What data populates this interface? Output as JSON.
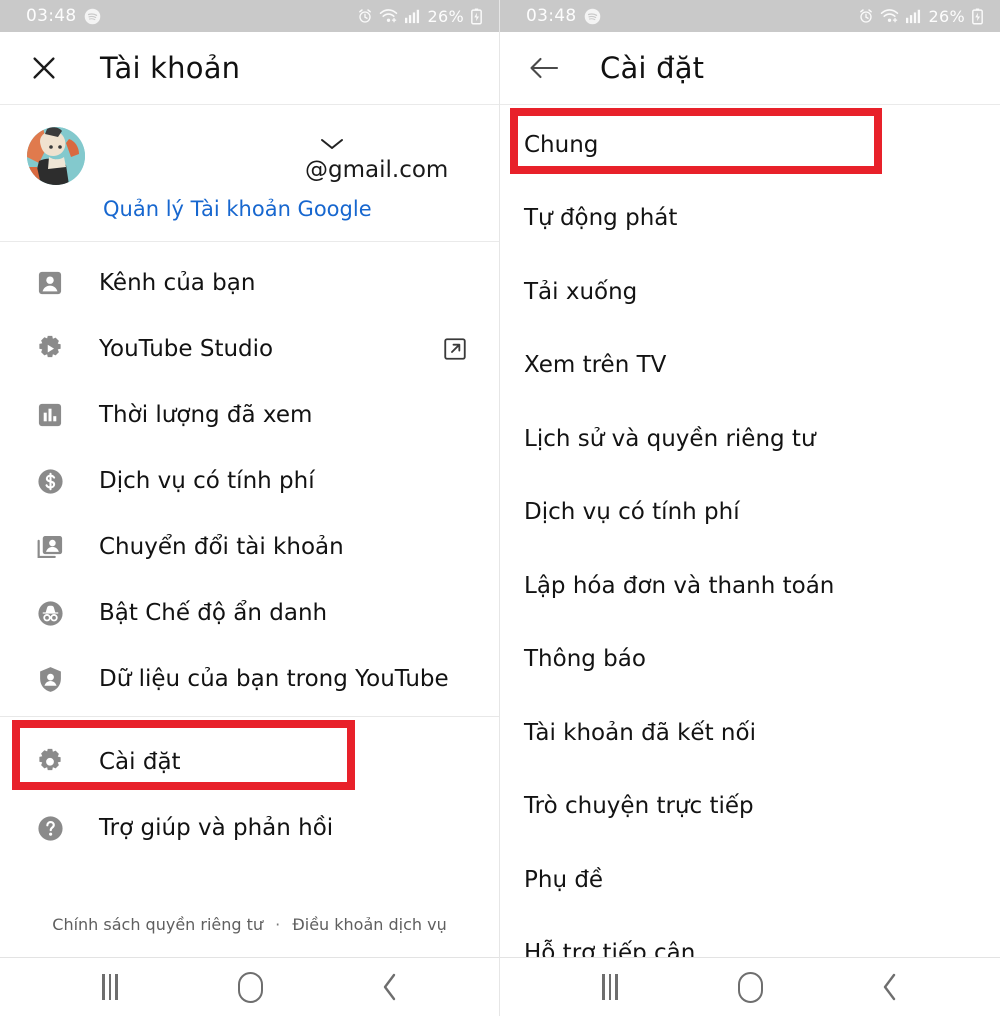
{
  "status_bar": {
    "time": "03:48",
    "spotify_icon": "spotify-icon",
    "alarm_icon": "alarm-clock-icon",
    "wifi_icon": "wifi-plus-icon",
    "signal_icon": "cellular-signal-icon",
    "battery_percent": "26%",
    "battery_icon": "battery-charging-icon"
  },
  "left_panel": {
    "appbar": {
      "close_icon": "close-x-icon",
      "title": "Tài khoản"
    },
    "account": {
      "avatar": "user-avatar",
      "expand_icon": "chevron-down-icon",
      "email": "@gmail.com",
      "manage_link": "Quản lý Tài khoản Google"
    },
    "menu": [
      {
        "icon": "account-box-icon",
        "label": "Kênh của bạn",
        "trailing": null
      },
      {
        "icon": "youtube-studio-icon",
        "label": "YouTube Studio",
        "trailing": "open-in-new-icon"
      },
      {
        "icon": "bar-chart-icon",
        "label": "Thời lượng đã xem",
        "trailing": null
      },
      {
        "icon": "dollar-circle-icon",
        "label": "Dịch vụ có tính phí",
        "trailing": null
      },
      {
        "icon": "switch-account-icon",
        "label": "Chuyển đổi tài khoản",
        "trailing": null
      },
      {
        "icon": "incognito-icon",
        "label": "Bật Chế độ ẩn danh",
        "trailing": null
      },
      {
        "icon": "shield-person-icon",
        "label": "Dữ liệu của bạn trong YouTube",
        "trailing": null
      }
    ],
    "menu_bottom": [
      {
        "icon": "gear-icon",
        "label": "Cài đặt",
        "highlighted": true
      },
      {
        "icon": "help-circle-icon",
        "label": "Trợ giúp và phản hồi",
        "highlighted": false
      }
    ],
    "footer": {
      "privacy": "Chính sách quyền riêng tư",
      "separator": "·",
      "terms": "Điều khoản dịch vụ"
    }
  },
  "right_panel": {
    "appbar": {
      "back_icon": "arrow-left-icon",
      "title": "Cài đặt"
    },
    "settings": [
      {
        "label": "Chung",
        "highlighted": true
      },
      {
        "label": "Tự động phát",
        "highlighted": false
      },
      {
        "label": "Tải xuống",
        "highlighted": false
      },
      {
        "label": "Xem trên TV",
        "highlighted": false
      },
      {
        "label": "Lịch sử và quyền riêng tư",
        "highlighted": false
      },
      {
        "label": "Dịch vụ có tính phí",
        "highlighted": false
      },
      {
        "label": "Lập hóa đơn và thanh toán",
        "highlighted": false
      },
      {
        "label": "Thông báo",
        "highlighted": false
      },
      {
        "label": "Tài khoản đã kết nối",
        "highlighted": false
      },
      {
        "label": "Trò chuyện trực tiếp",
        "highlighted": false
      },
      {
        "label": "Phụ đề",
        "highlighted": false
      },
      {
        "label": "Hỗ trợ tiếp cận",
        "highlighted": false
      }
    ]
  },
  "nav_bar": {
    "recents_icon": "recent-apps-icon",
    "home_icon": "home-icon",
    "back_icon": "back-chevron-icon"
  },
  "colors": {
    "highlight_red": "#e8212a",
    "link_blue": "#1767cf",
    "statusbar_gray": "#c9c9c9",
    "icon_gray": "#868686"
  }
}
